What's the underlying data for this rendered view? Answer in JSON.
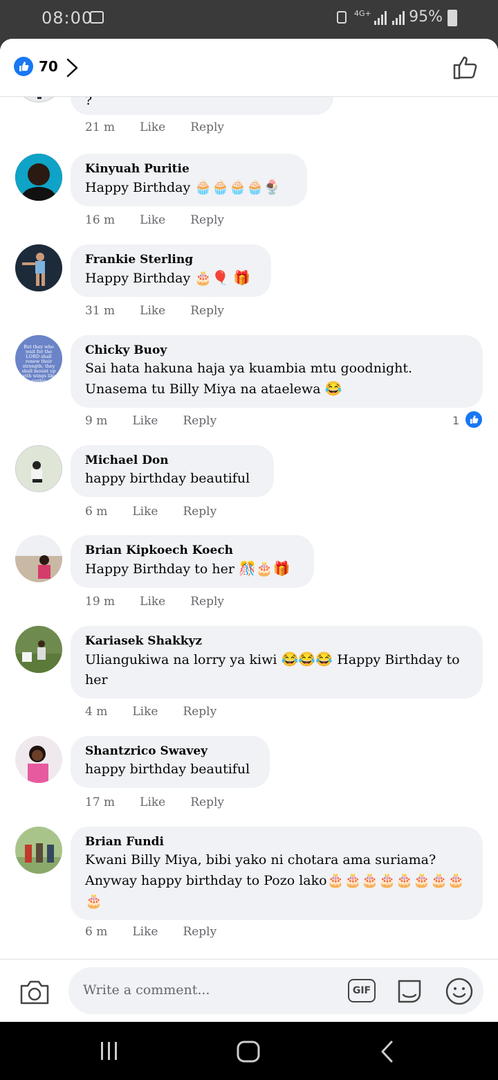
{
  "status_bar": {
    "time": "08:00",
    "network": "4G+",
    "battery": "95%"
  },
  "header": {
    "like_count": "70"
  },
  "comments": [
    {
      "author": "",
      "text": "Mahali ulitoa huyu kuna mwingine ?",
      "time": "21 m",
      "like": "Like",
      "reply": "Reply"
    },
    {
      "author": "Kinyuah Puritie",
      "text": "Happy Birthday",
      "emoji": "🧁🧁🧁🧁🍨",
      "time": "16 m",
      "like": "Like",
      "reply": "Reply"
    },
    {
      "author": "Frankie Sterling",
      "text": "Happy Birthday",
      "emoji": "🎂🎈 🎁",
      "time": "31 m",
      "like": "Like",
      "reply": "Reply"
    },
    {
      "author": "Chicky Buoy",
      "text": "Sai hata hakuna haja ya kuambia mtu goodnight. Unasema tu Billy Miya na ataelewa",
      "emoji": "😂",
      "time": "9 m",
      "like": "Like",
      "reply": "Reply",
      "reaction_count": "1"
    },
    {
      "author": "Michael Don",
      "text": "happy birthday beautiful",
      "time": "6 m",
      "like": "Like",
      "reply": "Reply"
    },
    {
      "author": "Brian Kipkoech Koech",
      "text": "Happy Birthday to her",
      "emoji": "🎊🎂🎁",
      "time": "19 m",
      "like": "Like",
      "reply": "Reply"
    },
    {
      "author": "Kariasek Shakkyz",
      "text": "Uliangukiwa na lorry ya kiwi",
      "emoji": "😂😂😂",
      "text2": "Happy Birthday to her",
      "time": "4 m",
      "like": "Like",
      "reply": "Reply"
    },
    {
      "author": "Shantzrico Swavey",
      "text": "happy birthday beautiful",
      "time": "17 m",
      "like": "Like",
      "reply": "Reply"
    },
    {
      "author": "Brian Fundi",
      "text": "Kwani Billy Miya, bibi yako ni chotara ama suriama? Anyway happy birthday to Pozo lako",
      "emoji": "🎂🎂🎂🎂🎂🎂🎂🎂🎂",
      "time": "6 m",
      "like": "Like",
      "reply": "Reply"
    }
  ],
  "avatar_quote": "But they who wait for the LORD shall renew their strength; they shall mount up with wings like eagles",
  "composer": {
    "placeholder": "Write a comment...",
    "gif_label": "GIF"
  },
  "colors": {
    "accent": "#1877f2",
    "bubble": "#f0f2f5",
    "meta": "#65676b",
    "status_bar": "#3a3a3a"
  },
  "icons": [
    "image-icon",
    "lock-icon",
    "signal-icon",
    "battery-icon",
    "like-icon",
    "chevron-right-icon",
    "thumbs-up-icon",
    "camera-icon",
    "gif-icon",
    "sticker-icon",
    "emoji-icon",
    "recent-apps-icon",
    "home-icon",
    "back-icon"
  ]
}
